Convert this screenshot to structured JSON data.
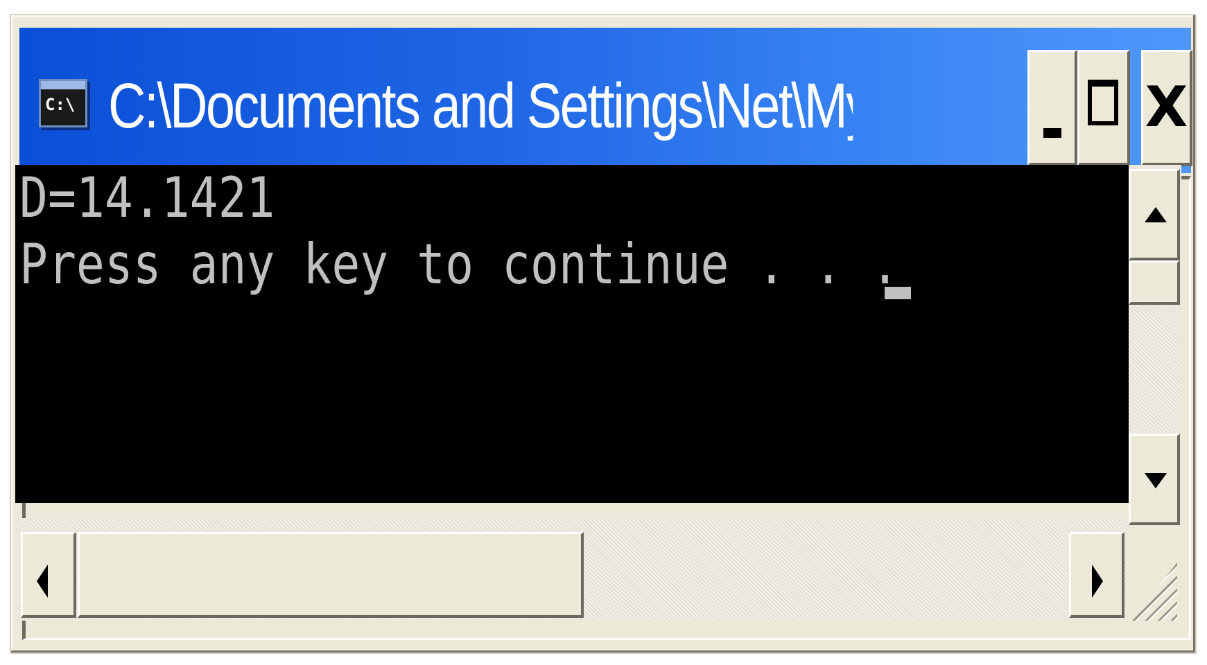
{
  "window": {
    "title": "C:\\Documents and Settings\\Net\\My Docu...",
    "icon_text": "C:\\",
    "icon": "console-icon"
  },
  "title_buttons": {
    "minimize_icon": "minimize-icon",
    "maximize_icon": "maximize-icon",
    "close_label": "X"
  },
  "console": {
    "lines": [
      "D=14.1421",
      "Press any key to continue . . ."
    ],
    "background": "#000000",
    "foreground": "#c0c0c0"
  },
  "scrollbars": {
    "vertical_up_icon": "arrow-up-icon",
    "vertical_down_icon": "arrow-down-icon",
    "horizontal_left_icon": "arrow-left-icon",
    "horizontal_right_icon": "arrow-right-icon"
  },
  "colors": {
    "titlebar_start": "#0a4fd6",
    "titlebar_end": "#4f97fb",
    "chrome": "#ece9d8"
  }
}
